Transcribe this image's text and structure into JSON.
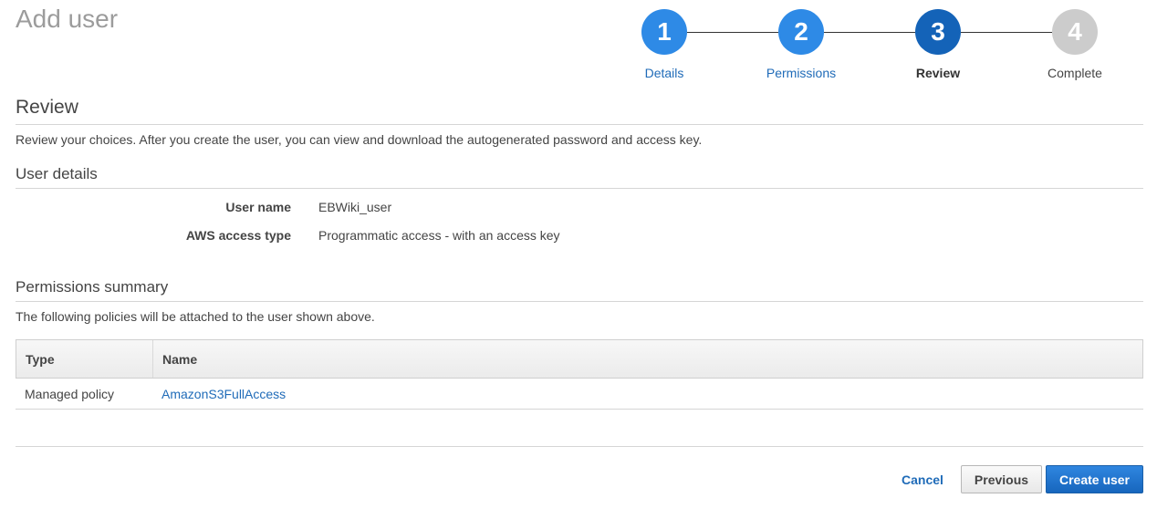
{
  "page": {
    "title": "Add user"
  },
  "stepper": {
    "steps": [
      {
        "number": "1",
        "label": "Details",
        "state": "completed"
      },
      {
        "number": "2",
        "label": "Permissions",
        "state": "completed"
      },
      {
        "number": "3",
        "label": "Review",
        "state": "active"
      },
      {
        "number": "4",
        "label": "Complete",
        "state": "future"
      }
    ],
    "colors": {
      "completed": "#2e8ae6",
      "active": "#1463b8",
      "future": "#cccccc"
    }
  },
  "review": {
    "heading": "Review",
    "description": "Review your choices. After you create the user, you can view and download the autogenerated password and access key."
  },
  "user_details": {
    "heading": "User details",
    "fields": [
      {
        "label": "User name",
        "value": "EBWiki_user"
      },
      {
        "label": "AWS access type",
        "value": "Programmatic access - with an access key"
      }
    ]
  },
  "permissions": {
    "heading": "Permissions summary",
    "description": "The following policies will be attached to the user shown above.",
    "table": {
      "columns": [
        "Type",
        "Name"
      ],
      "rows": [
        {
          "type": "Managed policy",
          "name": "AmazonS3FullAccess"
        }
      ]
    }
  },
  "footer": {
    "cancel_label": "Cancel",
    "previous_label": "Previous",
    "create_label": "Create user"
  }
}
